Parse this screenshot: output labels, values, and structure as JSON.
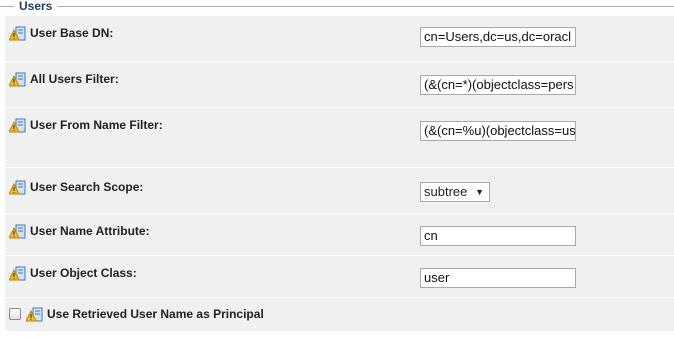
{
  "section": {
    "legend": "Users"
  },
  "fields": [
    {
      "label": "User Base DN:",
      "value": "cn=Users,dc=us,dc=oracl",
      "icon": "server-config-icon"
    },
    {
      "label": "All Users Filter:",
      "value": "(&(cn=*)(objectclass=pers",
      "icon": "server-config-icon"
    },
    {
      "label": "User From Name Filter:",
      "value": "(&(cn=%u)(objectclass=us",
      "icon": "server-config-icon"
    },
    {
      "label": "User Search Scope:",
      "value": "subtree",
      "icon": "server-config-icon"
    },
    {
      "label": "User Name Attribute:",
      "value": "cn",
      "icon": "server-config-icon"
    },
    {
      "label": "User Object Class:",
      "value": "user",
      "icon": "server-config-icon"
    },
    {
      "label": "Use Retrieved User Name as Principal",
      "checked": false,
      "icon": "server-config-icon"
    }
  ]
}
